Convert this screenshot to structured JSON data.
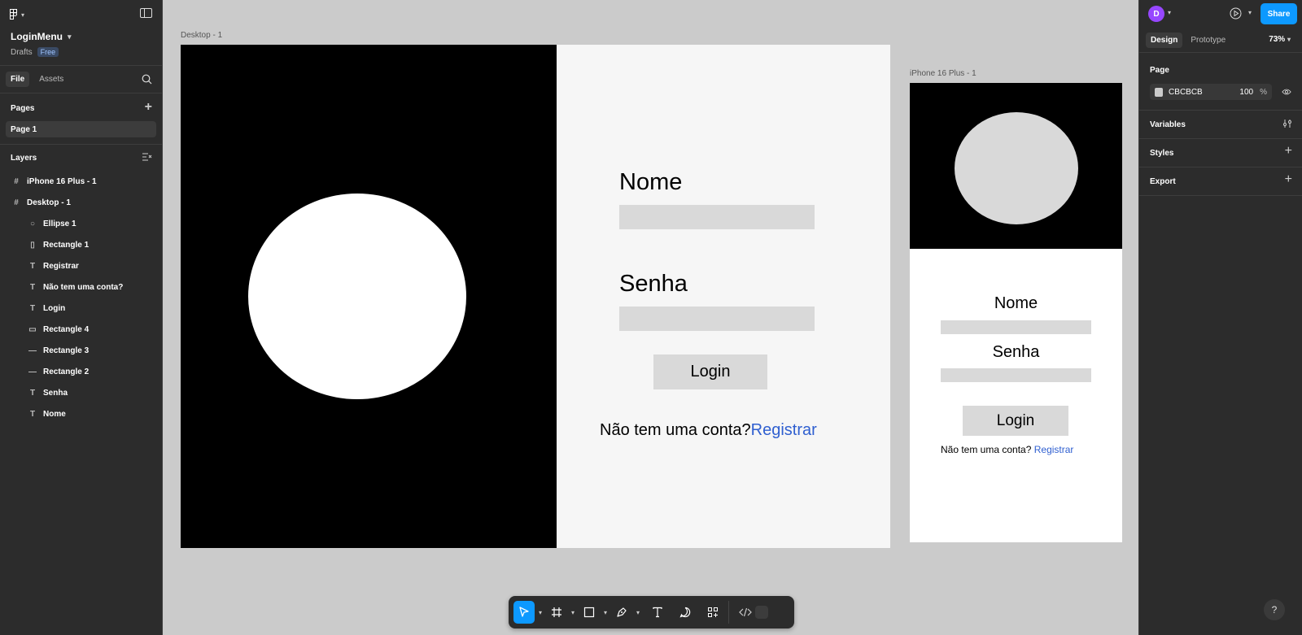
{
  "file": {
    "name": "LoginMenu",
    "location": "Drafts",
    "plan": "Free"
  },
  "left_panel": {
    "tabs": [
      "File",
      "Assets"
    ],
    "pages_title": "Pages",
    "pages": [
      "Page 1"
    ],
    "layers_title": "Layers",
    "layers": [
      {
        "name": "iPhone 16 Plus - 1",
        "icon": "frame-icon",
        "level": 0
      },
      {
        "name": "Desktop - 1",
        "icon": "frame-icon",
        "level": 0
      },
      {
        "name": "Ellipse 1",
        "icon": "ellipse-icon",
        "level": 1
      },
      {
        "name": "Rectangle 1",
        "icon": "rectangle-icon",
        "level": 1
      },
      {
        "name": "Registrar",
        "icon": "text-icon",
        "level": 1
      },
      {
        "name": "Não tem uma conta?",
        "icon": "text-icon",
        "level": 1
      },
      {
        "name": "Login",
        "icon": "text-icon",
        "level": 1
      },
      {
        "name": "Rectangle 4",
        "icon": "rectangle-icon",
        "level": 1
      },
      {
        "name": "Rectangle 3",
        "icon": "line-icon",
        "level": 1
      },
      {
        "name": "Rectangle 2",
        "icon": "line-icon",
        "level": 1
      },
      {
        "name": "Senha",
        "icon": "text-icon",
        "level": 1
      },
      {
        "name": "Nome",
        "icon": "text-icon",
        "level": 1
      }
    ]
  },
  "right_panel": {
    "avatar_initial": "D",
    "share_label": "Share",
    "tabs": [
      "Design",
      "Prototype"
    ],
    "zoom": "73%",
    "page_section": "Page",
    "page_color": "CBCBCB",
    "page_opacity": "100",
    "page_opacity_unit": "%",
    "sections": [
      "Variables",
      "Styles",
      "Export"
    ]
  },
  "canvas": {
    "background": "#cbcbcb",
    "desktop": {
      "label": "Desktop - 1",
      "nome": "Nome",
      "senha": "Senha",
      "login": "Login",
      "no_account": "Não tem uma conta?",
      "register": "Registrar"
    },
    "iphone": {
      "label": "iPhone 16 Plus - 1",
      "nome": "Nome",
      "senha": "Senha",
      "login": "Login",
      "no_account": "Não tem uma conta?",
      "register": "Registrar"
    }
  },
  "toolbar": {
    "tools": [
      "move-tool-icon",
      "frame-tool-icon",
      "rectangle-tool-icon",
      "pen-tool-icon",
      "text-tool-icon",
      "comment-tool-icon",
      "actions-tool-icon",
      "dev-mode-icon"
    ]
  },
  "help_label": "?",
  "colors": {
    "accent": "#0d99ff",
    "panel": "#2c2c2c",
    "link": "#2f5fd0",
    "avatar": "#9747ff"
  }
}
